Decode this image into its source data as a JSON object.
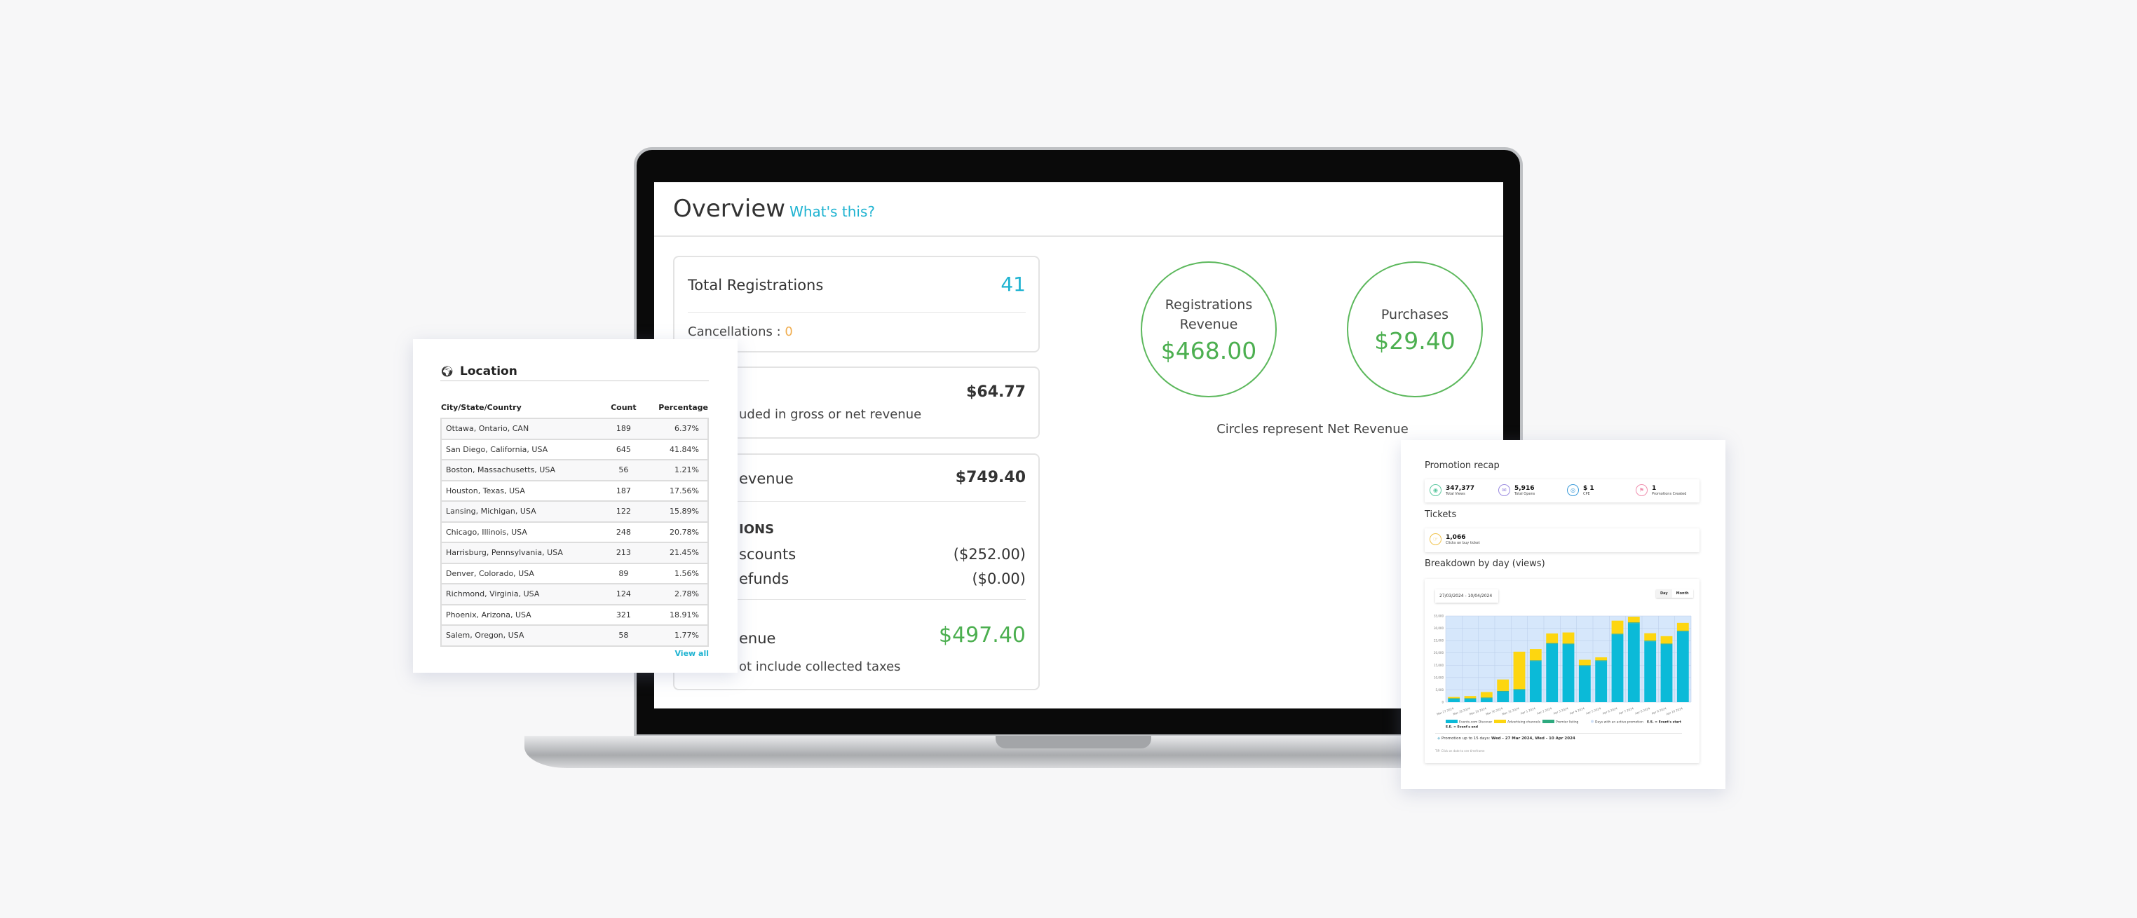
{
  "overview": {
    "title": "Overview",
    "whats_this": "What's this?",
    "total_registrations_label": "Total Registrations",
    "total_registrations": "41",
    "cancellations_label": "Cancellations : ",
    "cancellations": "0",
    "fees_amount": "$64.77",
    "fees_note_fragment": "uded in gross or net revenue",
    "gross_label_fragment": "evenue",
    "gross_amount": "$749.40",
    "deductions_fragment": "IONS",
    "discounts_fragment": "scounts",
    "discounts_amount": "($252.00)",
    "refunds_fragment": "efunds",
    "refunds_amount": "($0.00)",
    "net_label_fragment": "enue",
    "net_amount": "$497.40",
    "net_note_fragment": "ot include collected taxes",
    "circles": [
      {
        "label1": "Registrations",
        "label2": "Revenue",
        "amount": "$468.00"
      },
      {
        "label1": "Purchases",
        "amount": "$29.40"
      }
    ],
    "circles_note": "Circles represent Net Revenue",
    "colors": {
      "accent": "#1fb3d1",
      "positive": "#4caf50",
      "warning": "#f0ad4e"
    }
  },
  "location": {
    "title": "Location",
    "icon": "globe-icon",
    "headers": [
      "City/State/Country",
      "Count",
      "Percentage"
    ],
    "rows": [
      [
        "Ottawa, Ontario, CAN",
        "189",
        "6.37%"
      ],
      [
        "San Diego, California, USA",
        "645",
        "41.84%"
      ],
      [
        "Boston, Massachusetts, USA",
        "56",
        "1.21%"
      ],
      [
        "Houston, Texas, USA",
        "187",
        "17.56%"
      ],
      [
        "Lansing, Michigan, USA",
        "122",
        "15.89%"
      ],
      [
        "Chicago, Illinois, USA",
        "248",
        "20.78%"
      ],
      [
        "Harrisburg, Pennsylvania, USA",
        "213",
        "21.45%"
      ],
      [
        "Denver, Colorado, USA",
        "89",
        "1.56%"
      ],
      [
        "Richmond, Virginia, USA",
        "124",
        "2.78%"
      ],
      [
        "Phoenix, Arizona, USA",
        "321",
        "18.91%"
      ],
      [
        "Salem, Oregon, USA",
        "58",
        "1.77%"
      ]
    ],
    "view_all": "View all"
  },
  "promotion": {
    "recap_title": "Promotion recap",
    "stats": [
      {
        "value": "347,377",
        "label": "Total Views",
        "icon": "eye-icon",
        "color": "#5cc8a0"
      },
      {
        "value": "5,916",
        "label": "Total Opens",
        "icon": "envelope-icon",
        "color": "#9b8be0"
      },
      {
        "value": "$ 1",
        "label": "CPE",
        "icon": "target-icon",
        "color": "#3a9ad9"
      },
      {
        "value": "1",
        "label": "Promotions Created",
        "icon": "megaphone-icon",
        "color": "#ef8fae"
      }
    ],
    "tickets_title": "Tickets",
    "tickets": {
      "value": "1,066",
      "label": "Clicks on buy ticket",
      "icon": "hand-click-icon",
      "color": "#f0c24a"
    },
    "breakdown_title": "Breakdown by day (views)",
    "date_range": "27/03/2024 - 10/04/2024",
    "toggle": [
      "Day",
      "Month"
    ],
    "note_prefix": "Promotion up to 15 days: ",
    "note_dates": "Wed - 27 Mar 2024, Wed - 10 Apr 2024",
    "tip": "TIP: Click on date to see timeframe"
  },
  "chart_data": {
    "type": "bar",
    "stacked": true,
    "ylim": [
      0,
      35000
    ],
    "grid": true,
    "legend_placement": "bottom",
    "yticks": [
      "0",
      "5,000",
      "10,000",
      "15,000",
      "20,000",
      "25,000",
      "30,000",
      "35,000"
    ],
    "categories": [
      "Mar 27 2024",
      "Mar 28 2024",
      "Mar 29 2024",
      "Mar 30 2024",
      "Mar 31 2024",
      "Apr 1 2024",
      "Apr 2 2024",
      "Apr 3 2024",
      "Apr 4 2024",
      "Apr 5 2024",
      "Apr 6 2024",
      "Apr 7 2024",
      "Apr 8 2024",
      "Apr 9 2024",
      "Apr 10 2024"
    ],
    "series": [
      {
        "name": "Events.com Discover",
        "color": "#0bbad8",
        "values": [
          1300,
          1300,
          1600,
          4300,
          5000,
          16700,
          23700,
          23500,
          14700,
          16700,
          27500,
          32100,
          24700,
          23500,
          28700
        ]
      },
      {
        "name": "Premier listing",
        "color": "#2eaa7f",
        "values": [
          300,
          300,
          300,
          300,
          300,
          300,
          300,
          300,
          300,
          300,
          300,
          300,
          300,
          300,
          300
        ]
      },
      {
        "name": "Advertising channels",
        "color": "#fdd610",
        "values": [
          500,
          900,
          2200,
          4600,
          15200,
          4600,
          3900,
          4500,
          2200,
          1200,
          5300,
          2300,
          3000,
          3000,
          3200
        ]
      }
    ],
    "legend_extra": [
      "Days with an active promotion",
      "E.S. = Event's start",
      "E.E. = Event's end"
    ],
    "background_color": "#d6e7fb"
  }
}
